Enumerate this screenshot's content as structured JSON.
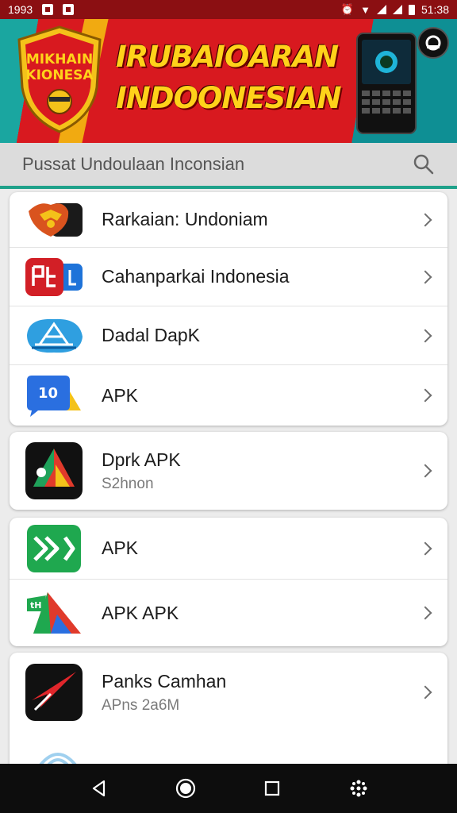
{
  "status_bar": {
    "left_time": "1993",
    "right_time": "51:38"
  },
  "banner": {
    "shield_text_line1": "MIKHAIN",
    "shield_text_line2": "KIONESA",
    "title_line1": "IRUBAIOARAN",
    "title_line2": "INDOONESIAN"
  },
  "search": {
    "placeholder": "Pussat Undoulaan Inconsian"
  },
  "apps": [
    {
      "title": "Rarkaian: Undoniam",
      "subtitle": "",
      "icon": "garuda-icon",
      "colors": [
        "#d9531e",
        "#1a1a1a"
      ]
    },
    {
      "title": "Cahanparkai Indonesia",
      "subtitle": "",
      "icon": "red-blue-app-icon",
      "colors": [
        "#d21f26",
        "#1e73d9"
      ]
    },
    {
      "title": "Dadal DapK",
      "subtitle": "",
      "icon": "landmark-icon",
      "colors": [
        "#2f9fe0"
      ]
    },
    {
      "title": "APK",
      "subtitle": "",
      "icon": "blue-chat-icon",
      "colors": [
        "#2a6fe0",
        "#f3c21a"
      ]
    },
    {
      "title": "Dprk APK",
      "subtitle": "S2hnon",
      "icon": "drive-icon",
      "colors": [
        "#111111",
        "#1fa15a",
        "#e03a2b"
      ]
    },
    {
      "title": "APK",
      "subtitle": "",
      "icon": "green-code-icon",
      "colors": [
        "#1fa84f"
      ]
    },
    {
      "title": "APK APK",
      "subtitle": "",
      "icon": "triangle-apk-icon",
      "colors": [
        "#1fa84f",
        "#e03a2b",
        "#2a6fe0"
      ]
    },
    {
      "title": "Panks Camhan",
      "subtitle": "APns 2a6M",
      "icon": "red-arrow-icon",
      "colors": [
        "#111111",
        "#e0262b"
      ]
    }
  ],
  "nav": {
    "back": "back-icon",
    "home": "home-icon",
    "recents": "recents-icon",
    "menu": "apps-grid-icon"
  }
}
